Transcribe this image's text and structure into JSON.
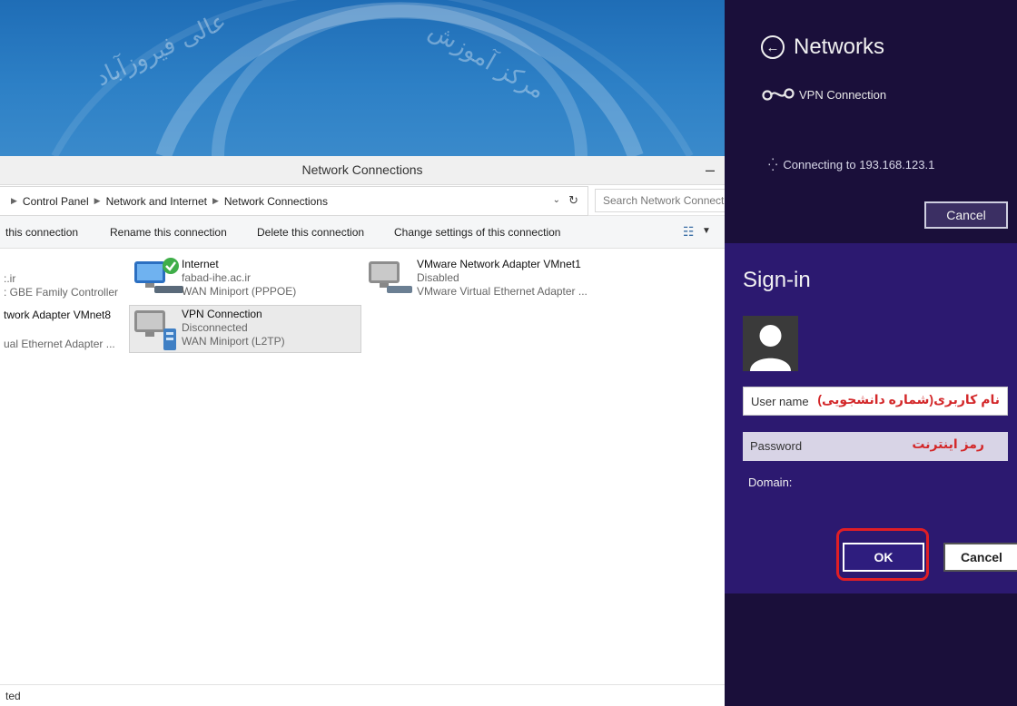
{
  "wallpaper": {
    "text_left": "عالی فیروزآباد",
    "text_right": "مرکز آموزش"
  },
  "window": {
    "title": "Network Connections",
    "minimize_symbol": "–"
  },
  "address_bar": {
    "crumbs": [
      "Control Panel",
      "Network and Internet",
      "Network Connections"
    ],
    "search_placeholder": "Search Network Connect"
  },
  "command_bar": {
    "commands": [
      "this connection",
      "Rename this connection",
      "Delete this connection",
      "Change settings of this connection"
    ]
  },
  "connections": {
    "partial_ir": {
      "line1": ":.ir",
      "line2": ": GBE Family Controller"
    },
    "internet": {
      "name": "Internet",
      "line2": "fabad-ihe.ac.ir",
      "line3": "WAN Miniport (PPPOE)"
    },
    "vmnet1": {
      "name": "VMware Network Adapter VMnet1",
      "line2": "Disabled",
      "line3": "VMware Virtual Ethernet Adapter ..."
    },
    "vmnet8": {
      "line1": "twork Adapter VMnet8",
      "line2": "ual Ethernet Adapter ..."
    },
    "vpn": {
      "name": "VPN Connection",
      "line2": "Disconnected",
      "line3": "WAN Miniport (L2TP)"
    }
  },
  "status_bar": {
    "text": "ted"
  },
  "networks_panel": {
    "title": "Networks",
    "vpn_name": "VPN Connection",
    "status": "Connecting to 193.168.123.1",
    "cancel_label": "Cancel"
  },
  "signin": {
    "title": "Sign-in",
    "username_placeholder": "User name",
    "username_annotation": "نام کاربری(شماره دانشجویی)",
    "password_placeholder": "Password",
    "password_annotation": "رمز اینترنت",
    "domain_label": "Domain:",
    "ok_label": "OK",
    "cancel_label": "Cancel"
  },
  "colors": {
    "charm_bg": "#1a0f3a",
    "signin_bg": "#2c1970",
    "annotation_red": "#e01e25",
    "wallpaper_blue": "#2d80c6"
  }
}
